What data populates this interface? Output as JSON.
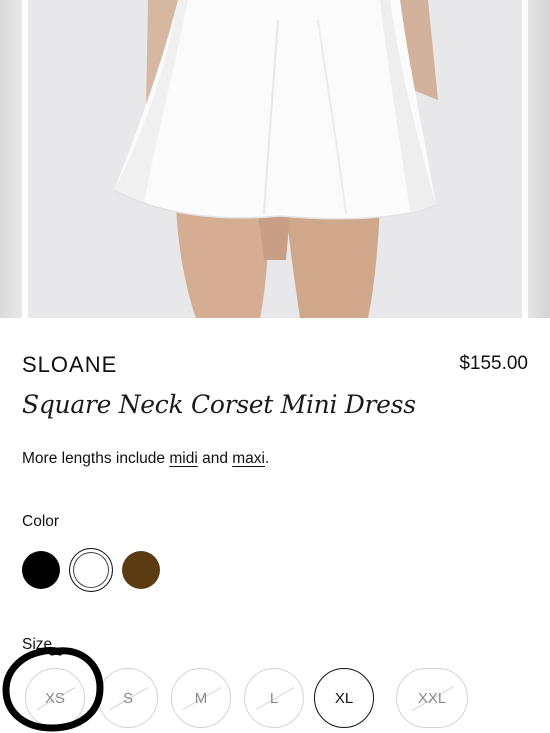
{
  "product": {
    "brand": "SLOANE",
    "price": "$155.00",
    "title": "Square Neck Corset Mini Dress",
    "lengths_prefix": "More lengths include ",
    "length_midi": "midi",
    "lengths_and": " and ",
    "length_maxi": "maxi",
    "lengths_suffix": "."
  },
  "color": {
    "label": "Color",
    "swatches": [
      {
        "name": "black",
        "hex": "#000000"
      },
      {
        "name": "white",
        "hex": "#ffffff",
        "selected": true
      },
      {
        "name": "brown",
        "hex": "#5a3b12"
      }
    ]
  },
  "size": {
    "label": "Size",
    "options": [
      {
        "label": "XS",
        "available": false
      },
      {
        "label": "S",
        "available": false
      },
      {
        "label": "M",
        "available": false
      },
      {
        "label": "L",
        "available": false
      },
      {
        "label": "XL",
        "available": true,
        "selected": true
      },
      {
        "label": "XXL",
        "available": false
      }
    ]
  }
}
